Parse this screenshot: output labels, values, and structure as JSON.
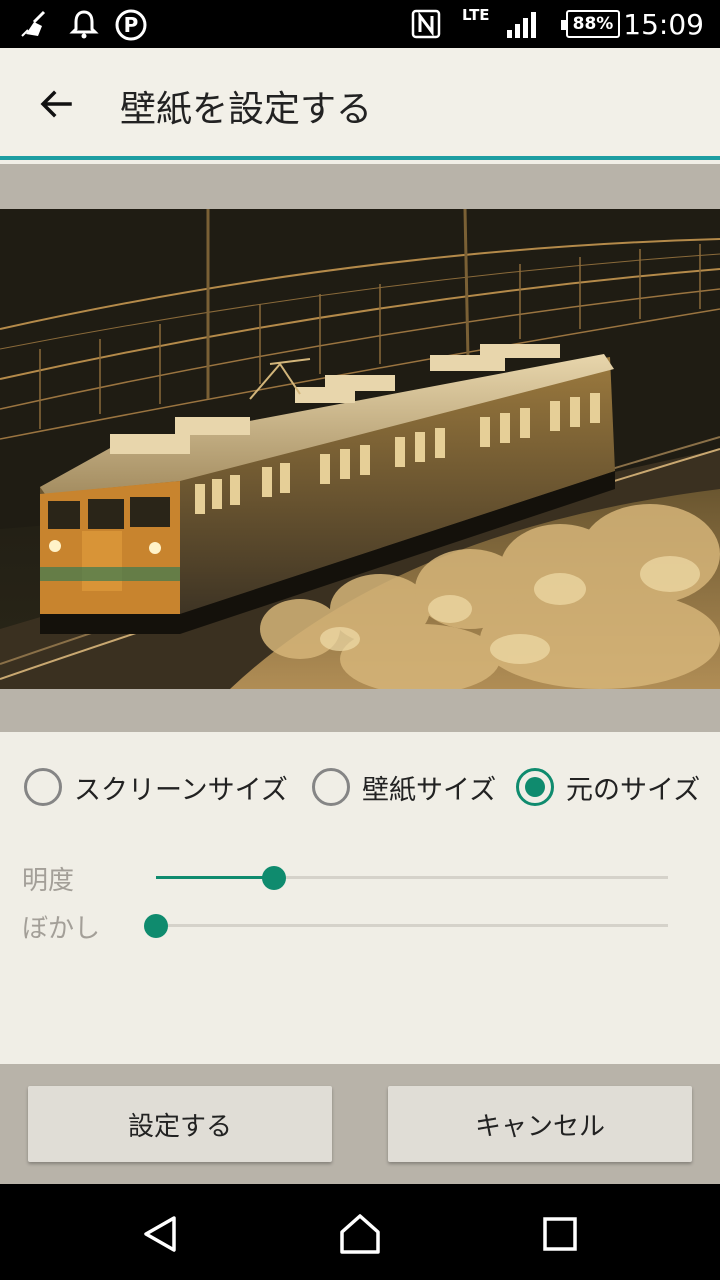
{
  "status_bar": {
    "time": "15:09",
    "network": "LTE",
    "battery": "88%",
    "icons_left": [
      "broom-icon",
      "notification-bell-icon",
      "parking-icon"
    ],
    "icons_right": [
      "nfc-icon",
      "signal-icon",
      "battery-icon"
    ]
  },
  "app_bar": {
    "back_icon": "arrow-back-icon",
    "title": "壁紙を設定する"
  },
  "preview": {
    "image": "train-photo"
  },
  "size_options": {
    "items": [
      {
        "label": "スクリーンサイズ",
        "selected": false
      },
      {
        "label": "壁紙サイズ",
        "selected": false
      },
      {
        "label": "元のサイズ",
        "selected": true
      }
    ]
  },
  "sliders": {
    "brightness": {
      "label": "明度",
      "value": 0.23
    },
    "blur": {
      "label": "ぼかし",
      "value": 0.0
    }
  },
  "buttons": {
    "set": "設定する",
    "cancel": "キャンセル"
  },
  "colors": {
    "accent": "#0f8b6e",
    "app_bar_underline": "#1e9ea2"
  }
}
